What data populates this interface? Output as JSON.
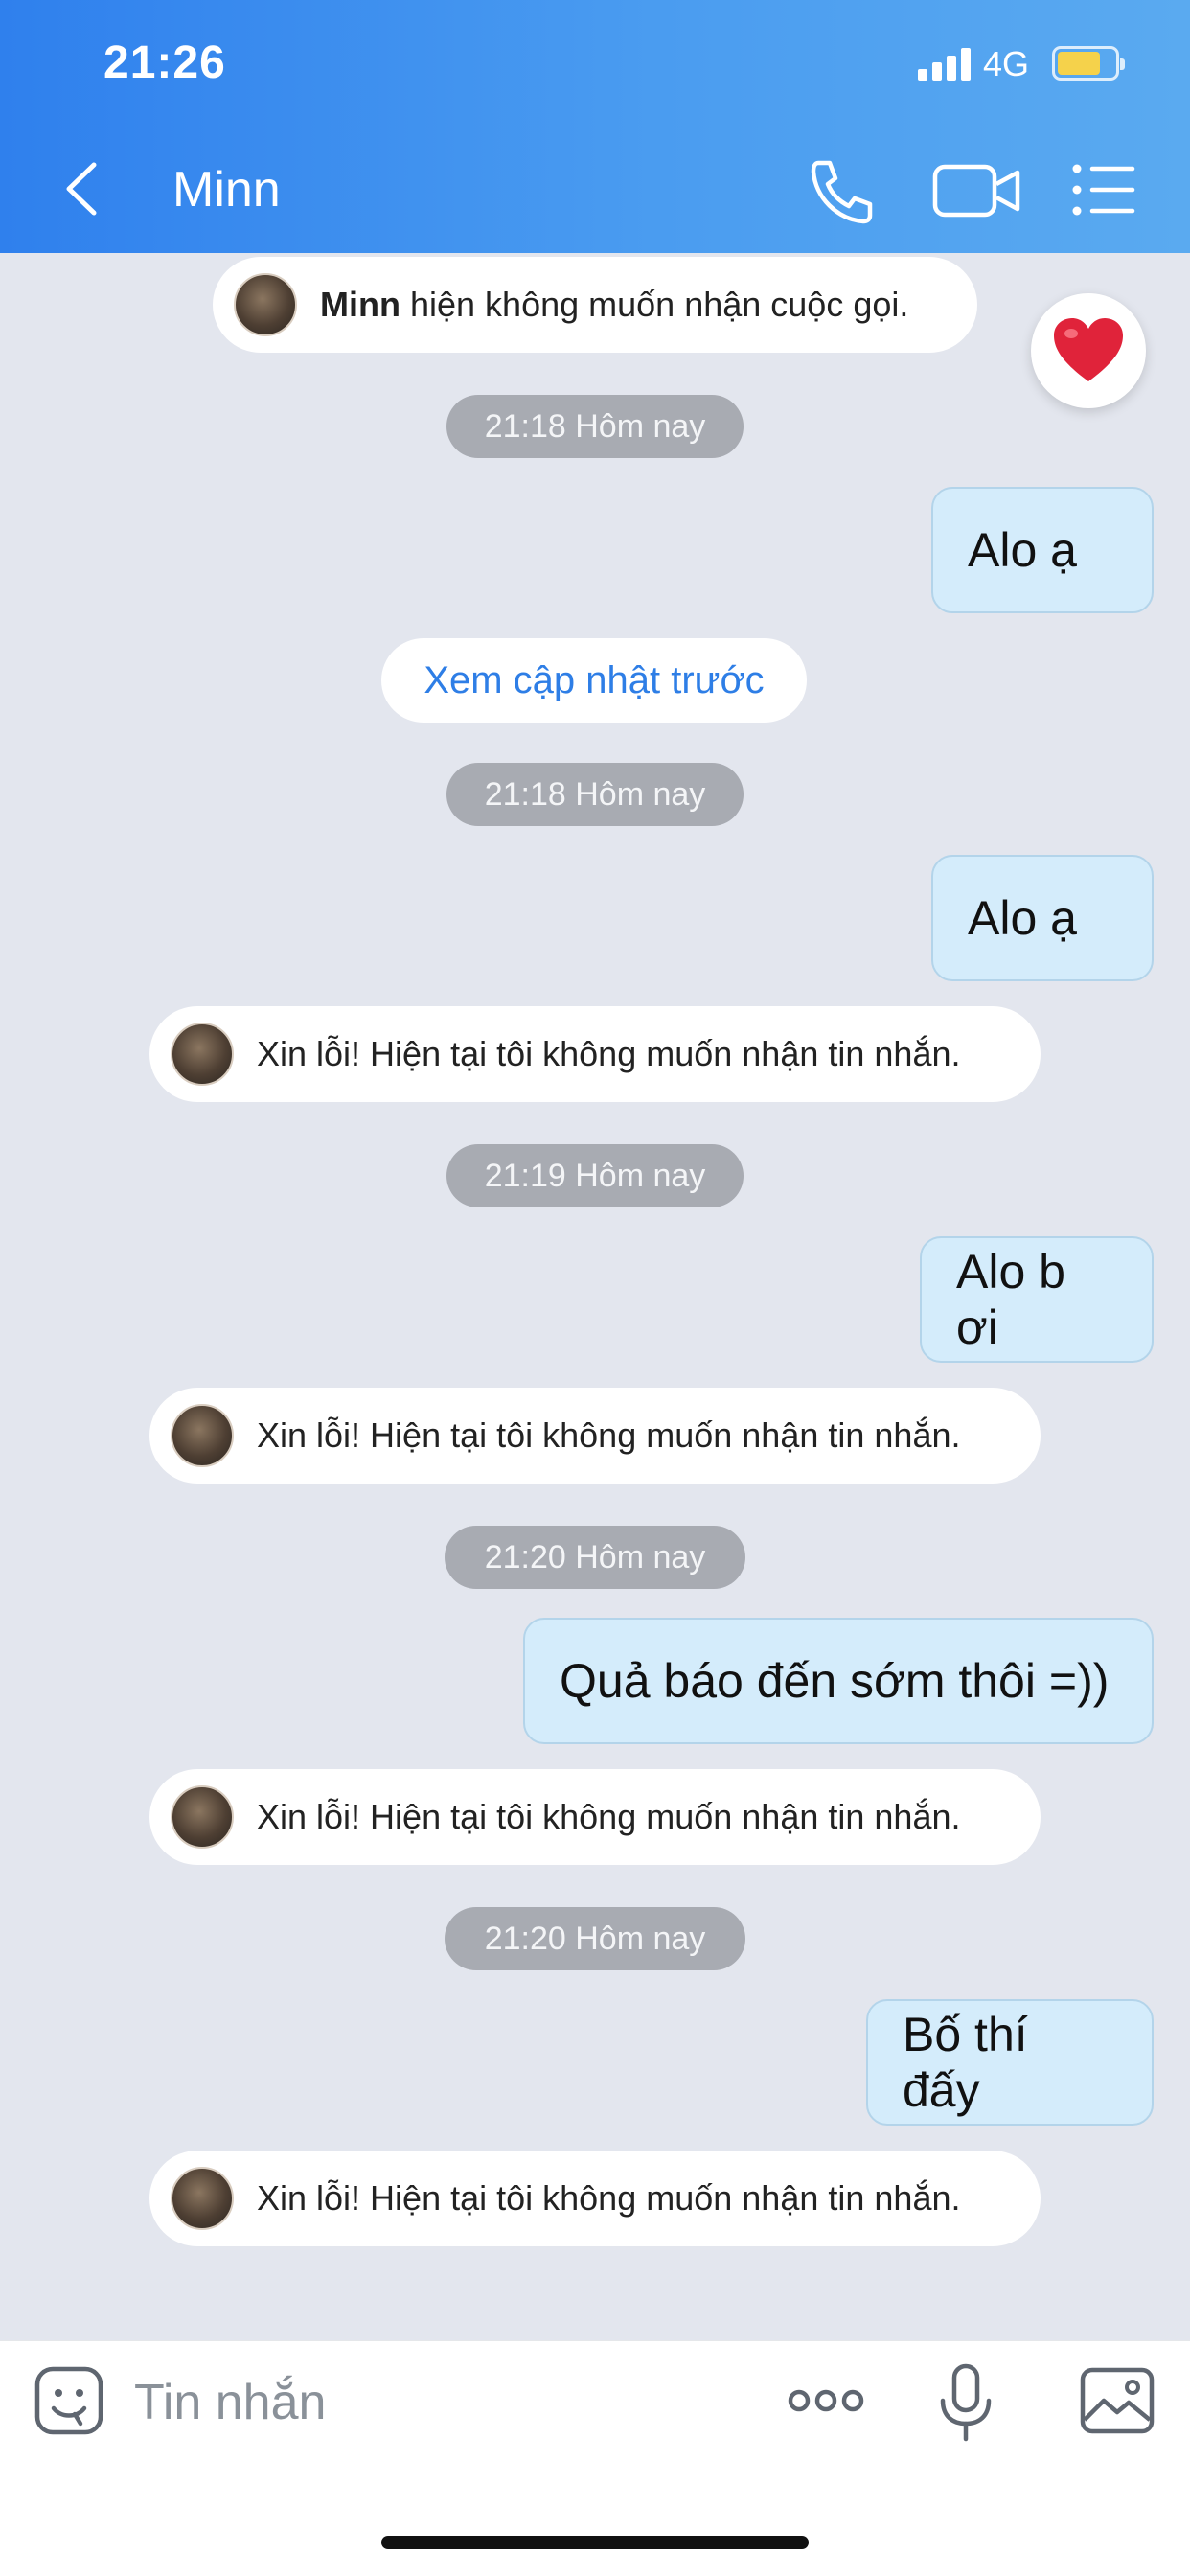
{
  "status_bar": {
    "time": "21:26",
    "network": "4G"
  },
  "header": {
    "contact_name": "Minn",
    "icons": [
      "chevron-left-icon",
      "phone-icon",
      "video-icon",
      "menu-icon"
    ]
  },
  "chat": {
    "call_notice": {
      "name": "Minn",
      "text": " hiện không muốn nhận cuộc gọi."
    },
    "timestamps": [
      "21:18 Hôm nay",
      "21:18 Hôm nay",
      "21:19 Hôm nay",
      "21:20 Hôm nay",
      "21:20 Hôm nay"
    ],
    "see_previous_label": "Xem cập nhật trước",
    "sent_messages": [
      "Alo ạ",
      "Alo ạ",
      "Alo b ơi",
      "Quả báo đến sớm thôi =))",
      "Bố thí đấy"
    ],
    "auto_reply": "Xin lỗi! Hiện tại tôi không muốn nhận tin nhắn.",
    "reaction_icon": "heart-icon"
  },
  "input": {
    "placeholder": "Tin nhắn",
    "icons": [
      "sticker-icon",
      "more-icon",
      "mic-icon",
      "image-icon"
    ]
  },
  "colors": {
    "header_start": "#2f80ed",
    "header_end": "#5aaaf0",
    "bubble_sent": "#d4ecfb",
    "link": "#2e7ee6",
    "chat_bg": "#e3e6ee"
  }
}
